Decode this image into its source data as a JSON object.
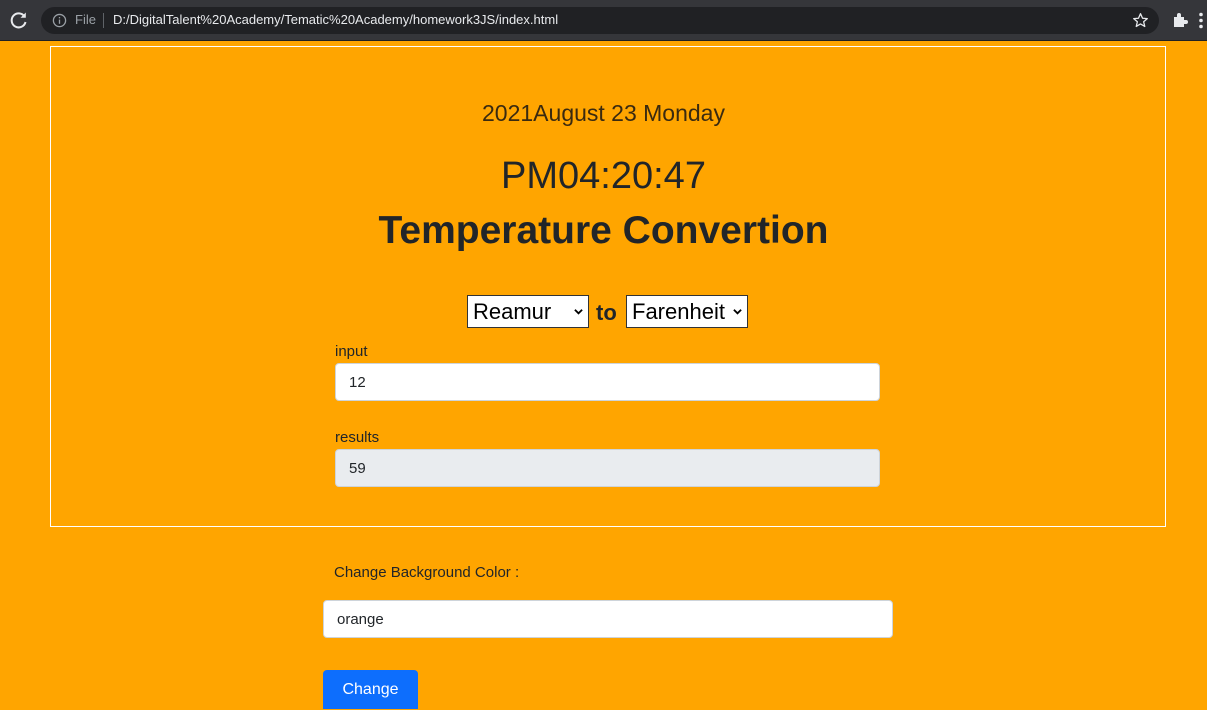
{
  "browser": {
    "file_label": "File",
    "url": "D:/DigitalTalent%20Academy/Tematic%20Academy/homework3JS/index.html",
    "icons": [
      "reload-icon",
      "info-icon",
      "star-icon",
      "extensions-icon",
      "menu-icon"
    ]
  },
  "clock": {
    "date": "2021August 23 Monday",
    "time": "PM04:20:47"
  },
  "converter": {
    "title": "Temperature Convertion",
    "from_unit": "Reamur",
    "to_label": "to",
    "to_unit": "Farenheit",
    "input_label": "input",
    "input_value": "12",
    "results_label": "results",
    "results_value": "59"
  },
  "background": {
    "label": "Change Background Color :",
    "value": "orange",
    "button_label": "Change",
    "current_color": "#ffa500"
  },
  "colors": {
    "page_background": "#ffa500",
    "button": "#0d6efd",
    "browser_chrome": "#35363a"
  }
}
